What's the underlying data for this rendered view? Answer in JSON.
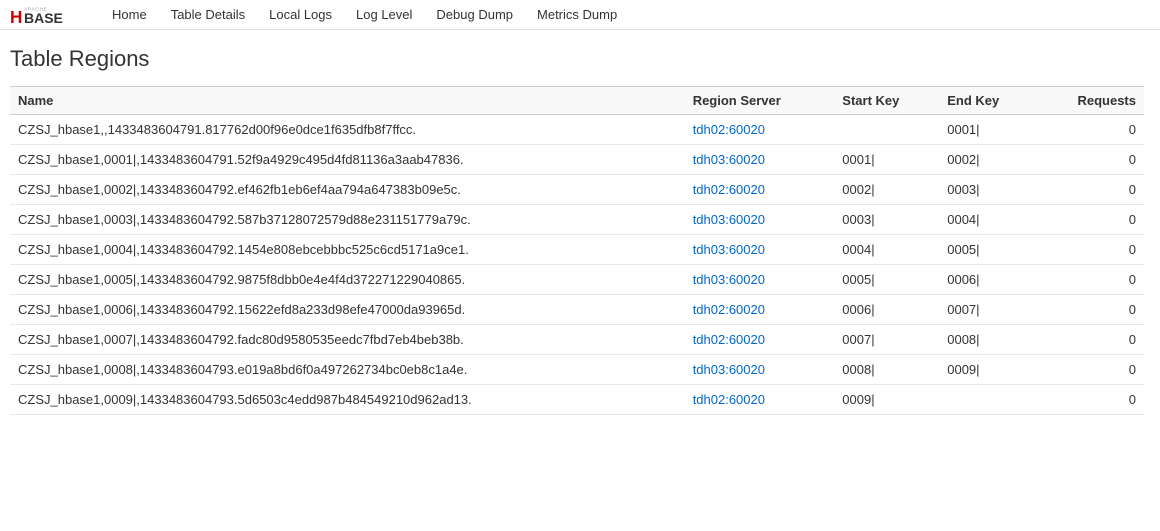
{
  "nav": {
    "links": [
      {
        "label": "Home",
        "href": "#"
      },
      {
        "label": "Table Details",
        "href": "#"
      },
      {
        "label": "Local Logs",
        "href": "#"
      },
      {
        "label": "Log Level",
        "href": "#"
      },
      {
        "label": "Debug Dump",
        "href": "#"
      },
      {
        "label": "Metrics Dump",
        "href": "#"
      }
    ]
  },
  "page": {
    "title": "Table Regions"
  },
  "table": {
    "columns": [
      {
        "key": "name",
        "label": "Name",
        "align": "left"
      },
      {
        "key": "regionServer",
        "label": "Region Server",
        "align": "left"
      },
      {
        "key": "startKey",
        "label": "Start Key",
        "align": "left"
      },
      {
        "key": "endKey",
        "label": "End Key",
        "align": "left"
      },
      {
        "key": "requests",
        "label": "Requests",
        "align": "right"
      }
    ],
    "rows": [
      {
        "name": "CZSJ_hbase1,,1433483604791.817762d00f96e0dce1f635dfb8f7ffcc.",
        "regionServer": "tdh02:60020",
        "startKey": "",
        "endKey": "0001|",
        "requests": "0"
      },
      {
        "name": "CZSJ_hbase1,0001|,1433483604791.52f9a4929c495d4fd81136a3aab47836.",
        "regionServer": "tdh03:60020",
        "startKey": "0001|",
        "endKey": "0002|",
        "requests": "0"
      },
      {
        "name": "CZSJ_hbase1,0002|,1433483604792.ef462fb1eb6ef4aa794a647383b09e5c.",
        "regionServer": "tdh02:60020",
        "startKey": "0002|",
        "endKey": "0003|",
        "requests": "0"
      },
      {
        "name": "CZSJ_hbase1,0003|,1433483604792.587b37128072579d88e231151779a79c.",
        "regionServer": "tdh03:60020",
        "startKey": "0003|",
        "endKey": "0004|",
        "requests": "0"
      },
      {
        "name": "CZSJ_hbase1,0004|,1433483604792.1454e808ebcebbbc525c6cd5171a9ce1.",
        "regionServer": "tdh03:60020",
        "startKey": "0004|",
        "endKey": "0005|",
        "requests": "0"
      },
      {
        "name": "CZSJ_hbase1,0005|,1433483604792.9875f8dbb0e4e4f4d372271229040865.",
        "regionServer": "tdh03:60020",
        "startKey": "0005|",
        "endKey": "0006|",
        "requests": "0"
      },
      {
        "name": "CZSJ_hbase1,0006|,1433483604792.15622efd8a233d98efe47000da93965d.",
        "regionServer": "tdh02:60020",
        "startKey": "0006|",
        "endKey": "0007|",
        "requests": "0"
      },
      {
        "name": "CZSJ_hbase1,0007|,1433483604792.fadc80d9580535eedc7fbd7eb4beb38b.",
        "regionServer": "tdh02:60020",
        "startKey": "0007|",
        "endKey": "0008|",
        "requests": "0"
      },
      {
        "name": "CZSJ_hbase1,0008|,1433483604793.e019a8bd6f0a497262734bc0eb8c1a4e.",
        "regionServer": "tdh03:60020",
        "startKey": "0008|",
        "endKey": "0009|",
        "requests": "0"
      },
      {
        "name": "CZSJ_hbase1,0009|,1433483604793.5d6503c4edd987b484549210d962ad13.",
        "regionServer": "tdh02:60020",
        "startKey": "0009|",
        "endKey": "",
        "requests": "0"
      }
    ]
  },
  "colors": {
    "link": "#0066cc",
    "accent": "#cc0000"
  }
}
